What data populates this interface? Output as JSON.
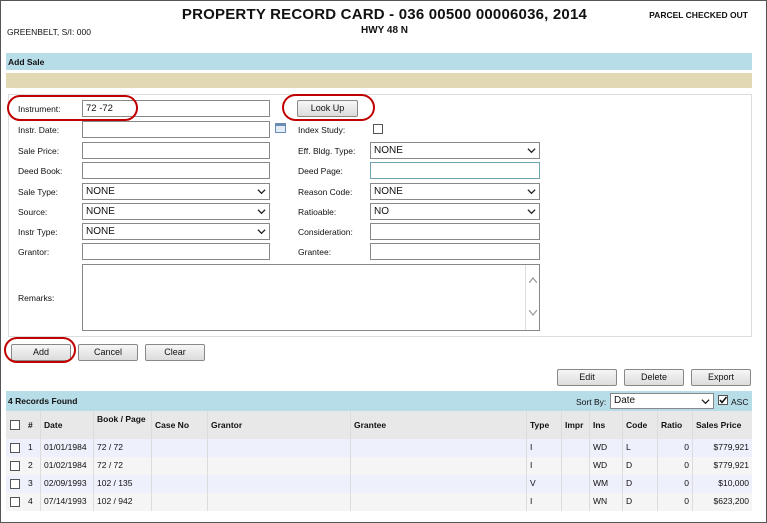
{
  "header": {
    "title": "PROPERTY RECORD CARD - 036 00500 00006036, 2014",
    "status": "PARCEL CHECKED OUT",
    "owner": "GREENBELT, S/I: 000",
    "road": "HWY 48 N"
  },
  "section": {
    "add_sale": "Add Sale"
  },
  "form": {
    "instrument": {
      "label": "Instrument:",
      "value": "72 -72"
    },
    "lookup": "Look Up",
    "instr_date": {
      "label": "Instr. Date:",
      "value": ""
    },
    "index_study": {
      "label": "Index Study:"
    },
    "sale_price": {
      "label": "Sale Price:",
      "value": ""
    },
    "eff_bldg_type": {
      "label": "Eff. Bldg. Type:",
      "value": "NONE"
    },
    "deed_book": {
      "label": "Deed Book:",
      "value": ""
    },
    "deed_page": {
      "label": "Deed Page:",
      "value": ""
    },
    "sale_type": {
      "label": "Sale Type:",
      "value": "NONE"
    },
    "reason_code": {
      "label": "Reason Code:",
      "value": "NONE"
    },
    "source": {
      "label": "Source:",
      "value": "NONE"
    },
    "ratioable": {
      "label": "Ratioable:",
      "value": "NO"
    },
    "instr_type": {
      "label": "Instr Type:",
      "value": "NONE"
    },
    "consideration": {
      "label": "Consideration:",
      "value": ""
    },
    "grantor": {
      "label": "Grantor:",
      "value": ""
    },
    "grantee": {
      "label": "Grantee:",
      "value": ""
    },
    "remarks": {
      "label": "Remarks:",
      "value": ""
    }
  },
  "form_buttons": {
    "add": "Add",
    "cancel": "Cancel",
    "clear": "Clear"
  },
  "table_buttons": {
    "edit": "Edit",
    "delete": "Delete",
    "export": "Export"
  },
  "records": {
    "count": "4 Records Found",
    "sort_label": "Sort By:",
    "sort_value": "Date",
    "asc_label": "ASC",
    "asc_checked": true,
    "columns": [
      "#",
      "Date",
      "Book / Page",
      "Case No",
      "Grantor",
      "Grantee",
      "Type",
      "Impr",
      "Ins",
      "Code",
      "Ratio",
      "Sales Price"
    ],
    "rows": [
      {
        "num": "1",
        "date": "01/01/1984",
        "book_page": "72 / 72",
        "case_no": "",
        "grantor": "",
        "grantee": "",
        "type": "I",
        "impr": "",
        "ins": "WD",
        "code": "L",
        "ratio": "0",
        "price": "$779,921"
      },
      {
        "num": "2",
        "date": "01/02/1984",
        "book_page": "72 / 72",
        "case_no": "",
        "grantor": "",
        "grantee": "",
        "type": "I",
        "impr": "",
        "ins": "WD",
        "code": "D",
        "ratio": "0",
        "price": "$779,921"
      },
      {
        "num": "3",
        "date": "02/09/1993",
        "book_page": "102 / 135",
        "case_no": "",
        "grantor": "",
        "grantee": "",
        "type": "V",
        "impr": "",
        "ins": "WM",
        "code": "D",
        "ratio": "0",
        "price": "$10,000"
      },
      {
        "num": "4",
        "date": "07/14/1993",
        "book_page": "102 / 942",
        "case_no": "",
        "grantor": "",
        "grantee": "",
        "type": "I",
        "impr": "",
        "ins": "WN",
        "code": "D",
        "ratio": "0",
        "price": "$623,200"
      }
    ]
  },
  "colors": {
    "section_blue": "#b7dde8",
    "tan_bar": "#e2d8b4",
    "highlight_ring": "#c00000"
  }
}
